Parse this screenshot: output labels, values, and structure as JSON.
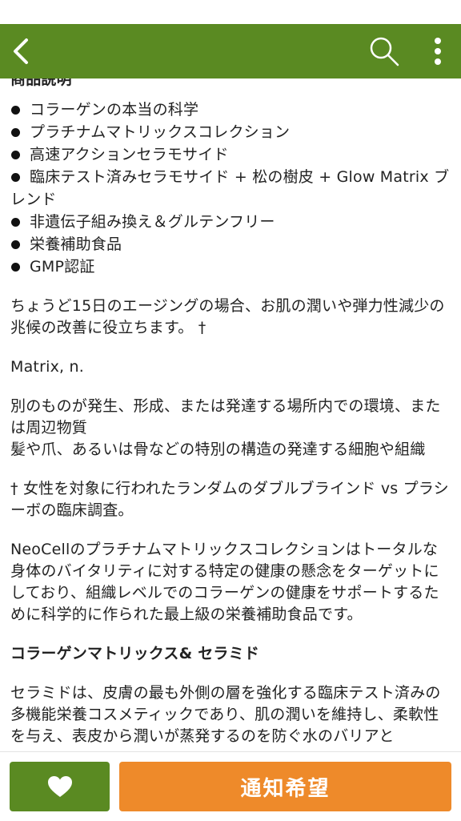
{
  "colors": {
    "header": "#5a8a22",
    "favorite_button": "#5a8a22",
    "notify_button": "#ee8a2a",
    "text": "#222222"
  },
  "header": {
    "back_icon": "chevron-left-icon",
    "search_icon": "search-icon",
    "menu_icon": "more-vertical-icon"
  },
  "description": {
    "section_title": "商品説明",
    "bullets": [
      "コラーゲンの本当の科学",
      "プラチナムマトリックスコレクション",
      "高速アクションセラモサイド",
      "臨床テスト済みセラモサイド + 松の樹皮 + Glow Matrix ブレンド",
      "非遺伝子組み換え＆グルテンフリー",
      "栄養補助食品",
      "GMP認証"
    ],
    "para_aging": "ちょうど15日のエージングの場合、お肌の潤いや弾力性減少の兆候の改善に役立ちます。 †",
    "matrix_term": "Matrix, n.",
    "matrix_definition_1": "別のものが発生、形成、または発達する場所内での環境、または周辺物質",
    "matrix_definition_2": "髪や爪、あるいは骨などの特別の構造の発達する細胞や組織",
    "footnote": "† 女性を対象に行われたランダムのダブルブラインド vs プラシーボの臨床調査。",
    "para_neocell": "NeoCellのプラチナムマトリックスコレクションはトータルな身体のバイタリティに対する特定の健康の懸念をターゲットにしており、組織レベルでのコラーゲンの健康をサポートするために科学的に作られた最上級の栄養補助食品です。",
    "subheading": "コラーゲンマトリックス& セラミド",
    "para_ceramide": "セラミドは、皮膚の最も外側の層を強化する臨床テスト済みの多機能栄養コスメティックであり、肌の潤いを維持し、柔軟性を与え、表皮から潤いが蒸発するのを防ぐ水のバリアと"
  },
  "bottom_bar": {
    "favorite_icon": "heart-icon",
    "notify_label": "通知希望"
  }
}
